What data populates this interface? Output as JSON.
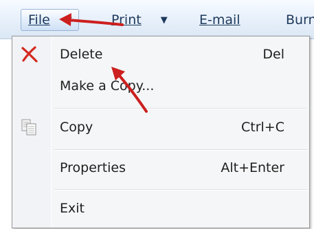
{
  "toolbar": {
    "file_label": "File",
    "print_label": "Print",
    "email_label": "E-mail",
    "burn_label": "Burn"
  },
  "menu": {
    "items": [
      {
        "label": "Delete",
        "shortcut": "Del",
        "icon": "red-x-delete-icon"
      },
      {
        "label": "Make a Copy...",
        "shortcut": "",
        "icon": ""
      },
      {
        "label": "Copy",
        "shortcut": "Ctrl+C",
        "icon": "copy-pages-icon"
      },
      {
        "label": "Properties",
        "shortcut": "Alt+Enter",
        "icon": ""
      },
      {
        "label": "Exit",
        "shortcut": "",
        "icon": ""
      }
    ]
  },
  "colors": {
    "toolbar_text": "#1e395b",
    "delete_icon": "#d42a20",
    "annotation_arrow": "#cc1f1f"
  }
}
